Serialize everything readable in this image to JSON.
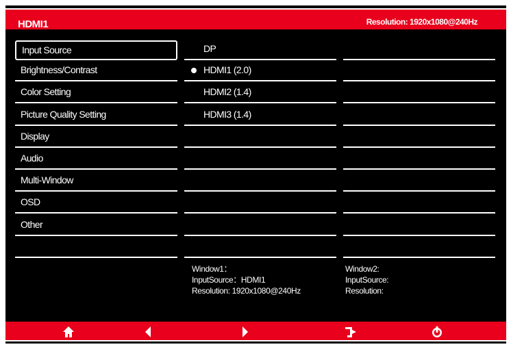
{
  "header": {
    "title": "HDMI1",
    "resolution": "Resolution: 1920x1080@240Hz"
  },
  "menu": [
    "Input Source",
    "Brightness/Contrast",
    "Color Setting",
    "Picture Quality Setting",
    "Display",
    "Audio",
    "Multi-Window",
    "OSD",
    "Other",
    ""
  ],
  "sources": [
    {
      "label": "DP",
      "selected": false
    },
    {
      "label": "HDMI1 (2.0)",
      "selected": true
    },
    {
      "label": "HDMI2 (1.4)",
      "selected": false
    },
    {
      "label": "HDMI3 (1.4)",
      "selected": false
    }
  ],
  "window1": {
    "title": "Window1：",
    "input": "InputSource：HDMI1",
    "resolution": "Resolution: 1920x1080@240Hz"
  },
  "window2": {
    "title": "Window2:",
    "input": "InputSource:",
    "resolution": "Resolution:"
  },
  "footer": {
    "icons": [
      "home-icon",
      "left-arrow-icon",
      "right-arrow-icon",
      "exit-icon",
      "power-icon"
    ]
  },
  "colors": {
    "accent": "#e8001c"
  }
}
